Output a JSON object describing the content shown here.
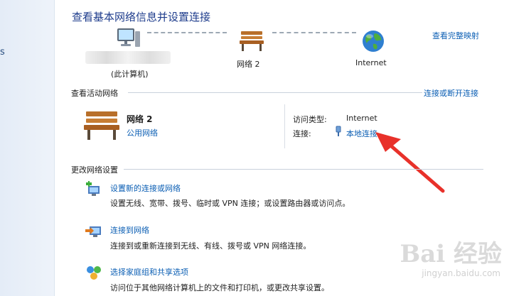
{
  "header": {
    "title": "查看基本网络信息并设置连接",
    "full_map_link": "查看完整映射"
  },
  "network_map": {
    "computer_label": "(此计算机)",
    "network_label": "网络  2",
    "internet_label": "Internet"
  },
  "active_networks": {
    "section_title": "查看活动网络",
    "connect_disconnect_link": "连接或断开连接",
    "network_name": "网络  2",
    "network_type": "公用网络",
    "access_type_label": "访问类型:",
    "access_type_value": "Internet",
    "connection_label": "连接:",
    "connection_value": "本地连接"
  },
  "change_settings": {
    "section_title": "更改网络设置",
    "tasks": [
      {
        "title": "设置新的连接或网络",
        "desc": "设置无线、宽带、拨号、临时或 VPN 连接；或设置路由器或访问点。",
        "icon": "new-connection-icon"
      },
      {
        "title": "连接到网络",
        "desc": "连接到或重新连接到无线、有线、拨号或 VPN 网络连接。",
        "icon": "connect-network-icon"
      },
      {
        "title": "选择家庭组和共享选项",
        "desc": "访问位于其他网络计算机上的文件和打印机，或更改共享设置。",
        "icon": "homegroup-icon"
      }
    ]
  },
  "left_pane": {
    "glyph": "s"
  },
  "watermark": {
    "brand": "Bai 经验",
    "url": "jingyan.baidu.com"
  },
  "colors": {
    "link": "#0c5fb4",
    "title": "#1e3c8c",
    "arrow": "#e8312a"
  }
}
